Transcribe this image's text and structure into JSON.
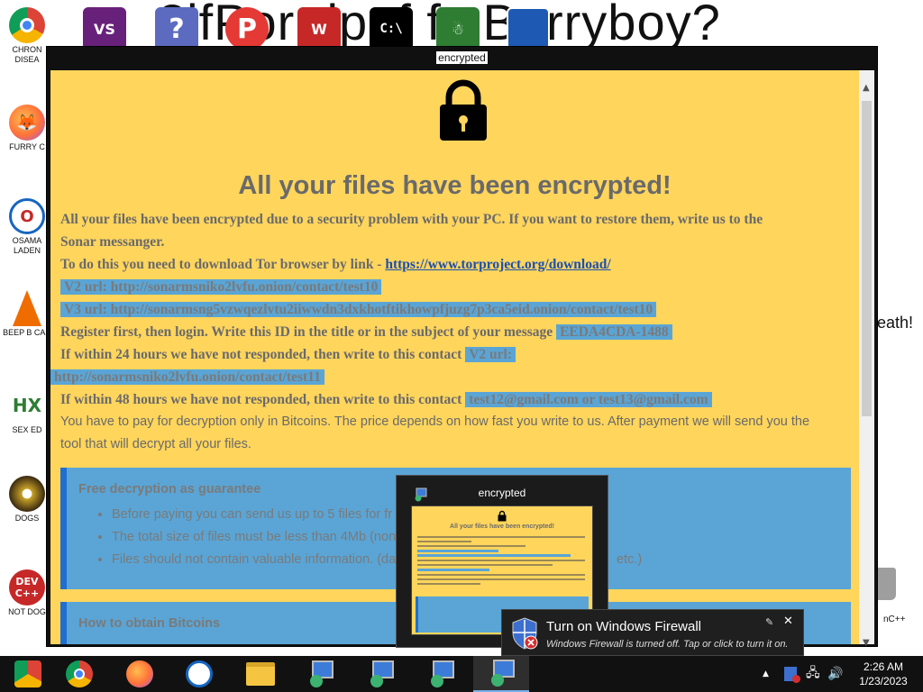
{
  "desktop": {
    "wallpaper_text": "?ifPor dpaf fc Berryboy?",
    "side_text": "eath!",
    "icons": [
      {
        "label": "CHRON DISEA",
        "color": "#2e7d32"
      },
      {
        "label": "FURRY C",
        "color": "#e65100"
      },
      {
        "label": "OSAMA LADEN",
        "color": "#1565c0"
      },
      {
        "label": "BEEP B CAR",
        "color": "#ef6c00"
      },
      {
        "label": "SEX ED",
        "color": "#333333"
      },
      {
        "label": "Dogs",
        "color": "#8d6e63"
      },
      {
        "label": "Not Dog",
        "color": "#c62828"
      }
    ],
    "right_icon_label": "nC++"
  },
  "window": {
    "title": "encrypted",
    "headline": "All your files have been encrypted!",
    "p1": "All your files have been encrypted due to a security problem with your PC. If you want to restore them, write us to the",
    "p1b": "Sonar messanger.",
    "p2": "To do this you need to download Tor browser by link -",
    "tor_link": "https://www.torproject.org/download/",
    "v2_url": "V2 url: http://sonarmsniko2lvfu.onion/contact/test10",
    "v3_url": "V3 url: http://sonarmsng5vzwqezlvtu2iiwwdn3dxkhotftikhowpfjuzg7p3ca5eid.onion/contact/test10",
    "register": "Register first, then login. Write this ID in the title or in the subject of your message",
    "id": "EEDA4CDA-1488",
    "c24": "If within 24 hours we have not responded, then write to this contact",
    "c24_v2": "V2 url:",
    "c24_url": "http://sonarmsniko2lvfu.onion/contact/test11",
    "c48": "If within 48 hours we have not responded, then write to this contact",
    "c48_mail": "test12@gmail.com or test13@gmail.com",
    "pay": "You have to pay for decryption only in Bitcoins. The price depends on how fast you write to us. After payment we will send you the",
    "pay2": "tool that will decrypt all your files.",
    "panel1": {
      "title": "Free decryption as guarantee",
      "items": [
        "Before paying you can send us up to 5 files for fr",
        "The total size of files must be less than 4Mb (non",
        "Files should not contain valuable information. (dat"
      ],
      "tail": "etc.)"
    },
    "panel2": {
      "title": "How to obtain Bitcoins"
    }
  },
  "thumbnail": {
    "title": "encrypted",
    "preview_title": "All your files have been encrypted!"
  },
  "toast": {
    "title": "Turn on Windows Firewall",
    "body": "Windows Firewall is turned off. Tap or click to turn it on."
  },
  "clock": {
    "time": "2:26 AM",
    "date": "1/23/2023"
  }
}
